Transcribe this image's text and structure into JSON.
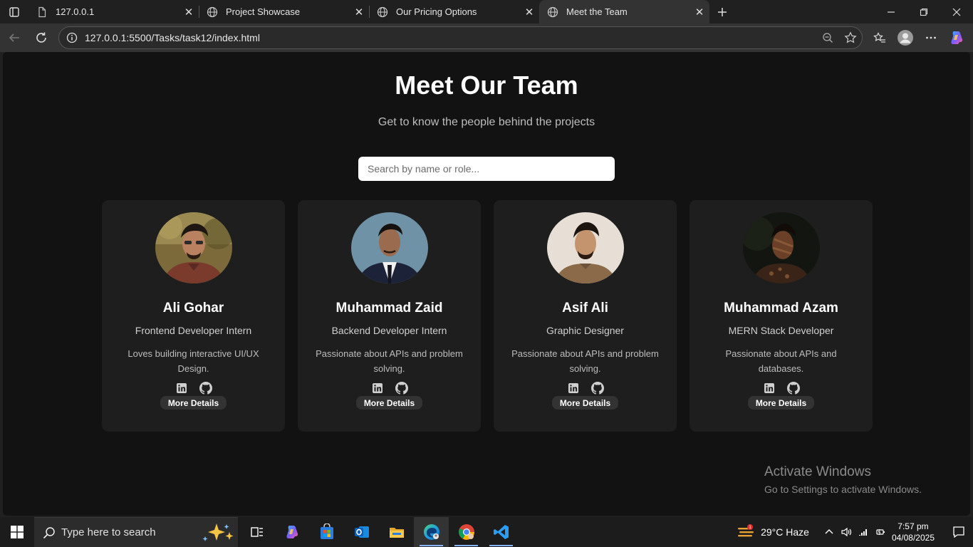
{
  "browser": {
    "tabs": [
      {
        "title": "127.0.0.1",
        "active": false
      },
      {
        "title": "Project Showcase",
        "active": false
      },
      {
        "title": "Our Pricing Options",
        "active": false
      },
      {
        "title": "Meet the Team",
        "active": true
      }
    ],
    "url": "127.0.0.1:5500/Tasks/task12/index.html"
  },
  "page": {
    "title": "Meet Our Team",
    "subtitle": "Get to know the people behind the projects",
    "search_placeholder": "Search by name or role...",
    "details_label": "More Details",
    "members": [
      {
        "name": "Ali Gohar",
        "role": "Frontend Developer Intern",
        "bio": "Loves building interactive UI/UX Design."
      },
      {
        "name": "Muhammad Zaid",
        "role": "Backend Developer Intern",
        "bio": "Passionate about APIs and problem solving."
      },
      {
        "name": "Asif Ali",
        "role": "Graphic Designer",
        "bio": "Passionate about APIs and problem solving."
      },
      {
        "name": "Muhammad Azam",
        "role": "MERN Stack Developer",
        "bio": "Passionate about APIs and databases."
      }
    ]
  },
  "watermark": {
    "line1": "Activate Windows",
    "line2": "Go to Settings to activate Windows."
  },
  "taskbar": {
    "search_placeholder": "Type here to search",
    "weather": "29°C  Haze",
    "time": "7:57 pm",
    "date": "04/08/2025"
  },
  "colors": {
    "page_bg": "#121212",
    "card_bg": "#1e1e1e",
    "button_bg": "#333333"
  }
}
